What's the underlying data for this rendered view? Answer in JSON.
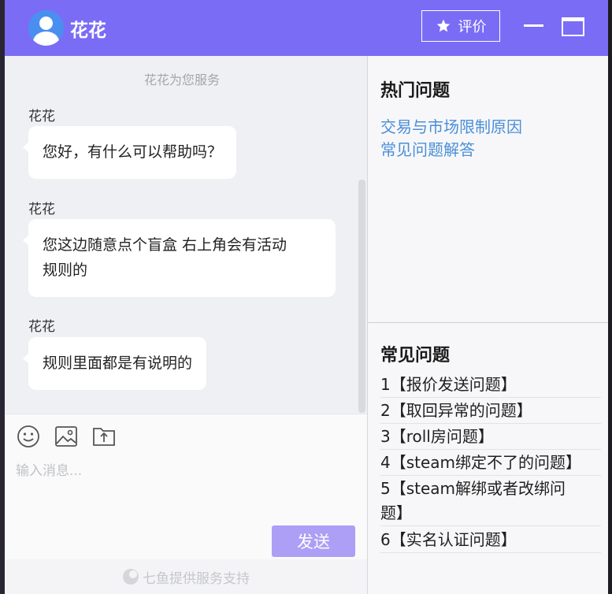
{
  "header": {
    "agent_name": "花花",
    "rate_label": "评价"
  },
  "chat": {
    "service_note": "花花为您服务",
    "messages": [
      {
        "sender": "花花",
        "lines": [
          "您好，有什么可以帮助吗？"
        ]
      },
      {
        "sender": "花花",
        "lines": [
          "您这边随意点个盲盒  右上角会有活动",
          "规则的"
        ]
      },
      {
        "sender": "花花",
        "lines": [
          "规则里面都是有说明的"
        ]
      }
    ]
  },
  "composer": {
    "placeholder": "输入消息...",
    "value": "",
    "send_label": "发送",
    "tools": [
      "emoji-icon",
      "image-icon",
      "upload-file-icon"
    ]
  },
  "footer": {
    "powered_by": "七鱼提供服务支持"
  },
  "sidebar": {
    "hot_title": "热门问题",
    "hot_links": [
      "交易与市场限制原因",
      "常见问题解答"
    ],
    "faq_title": "常见问题",
    "faq_items": [
      [
        "1【报价发送问题】"
      ],
      [
        "2【取回异常的问题】"
      ],
      [
        "3【roll房问题】"
      ],
      [
        "4【steam绑定不了的问题】"
      ],
      [
        "5【steam解绑或者改绑问",
        "题】"
      ],
      [
        "6【实名认证问题】"
      ]
    ]
  },
  "colors": {
    "header_bg": "#7b6cf6",
    "send_button": "#ad9ef6",
    "link": "#4a8fd8"
  }
}
